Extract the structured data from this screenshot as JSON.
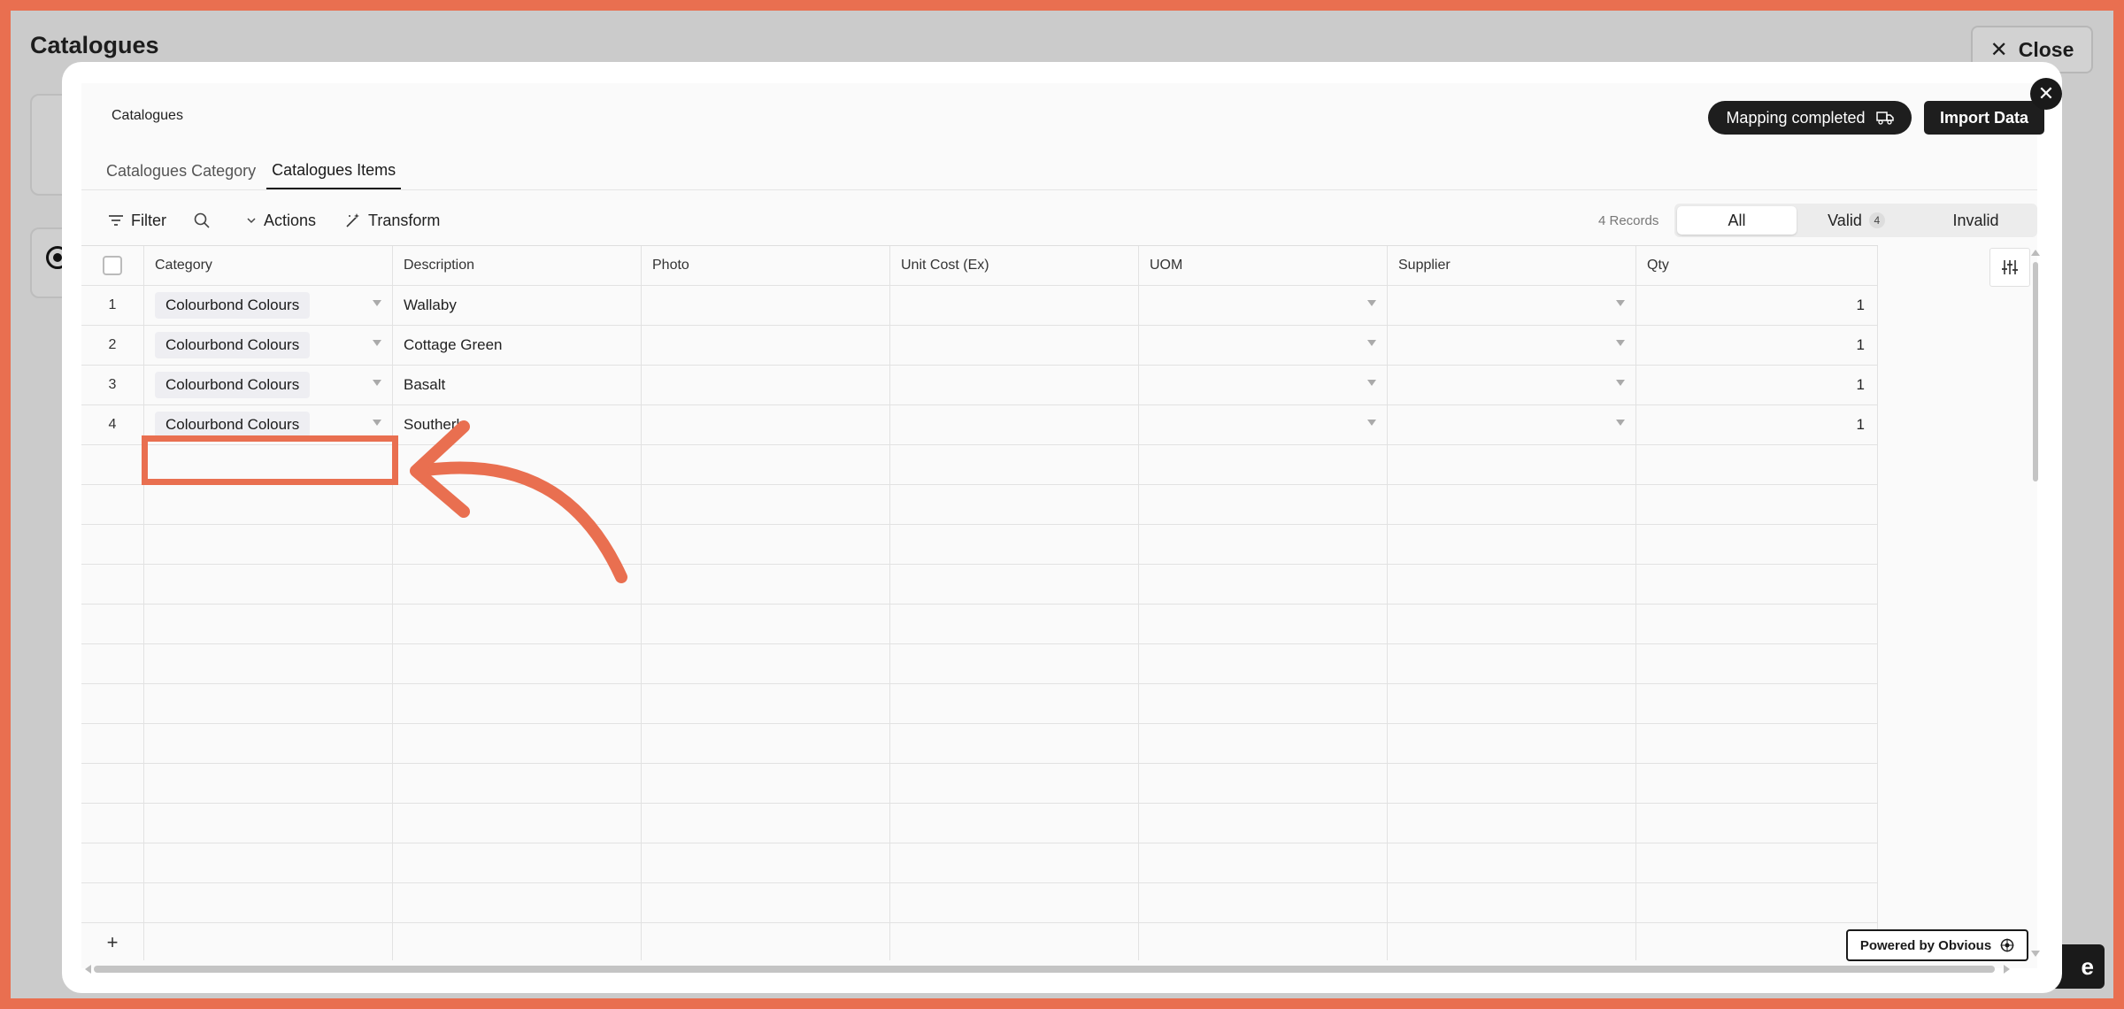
{
  "background": {
    "title": "Catalogues",
    "close_label": "Close",
    "save_fragment": "e"
  },
  "modal": {
    "header_title": "Catalogues",
    "mapping_label": "Mapping completed",
    "import_label": "Import Data",
    "tabs": [
      {
        "label": "Catalogues Category",
        "active": false
      },
      {
        "label": "Catalogues Items",
        "active": true
      }
    ],
    "toolbar": {
      "filter_label": "Filter",
      "actions_label": "Actions",
      "transform_label": "Transform",
      "records_label": "4 Records",
      "segments": [
        {
          "label": "All",
          "selected": true
        },
        {
          "label": "Valid",
          "count": "4",
          "selected": false
        },
        {
          "label": "Invalid",
          "selected": false
        }
      ]
    },
    "table": {
      "columns": [
        "Category",
        "Description",
        "Photo",
        "Unit Cost (Ex)",
        "UOM",
        "Supplier",
        "Qty"
      ],
      "rows": [
        {
          "num": "1",
          "category": "Colourbond Colours",
          "description": "Wallaby",
          "qty": "1"
        },
        {
          "num": "2",
          "category": "Colourbond Colours",
          "description": "Cottage Green",
          "qty": "1"
        },
        {
          "num": "3",
          "category": "Colourbond Colours",
          "description": "Basalt",
          "qty": "1"
        },
        {
          "num": "4",
          "category": "Colourbond Colours",
          "description": "Southerly",
          "qty": "1"
        }
      ],
      "add_row_label": "+"
    },
    "powered_label": "Powered by Obvious"
  },
  "colors": {
    "accent": "#e96f50",
    "dark": "#1e1e1e"
  }
}
